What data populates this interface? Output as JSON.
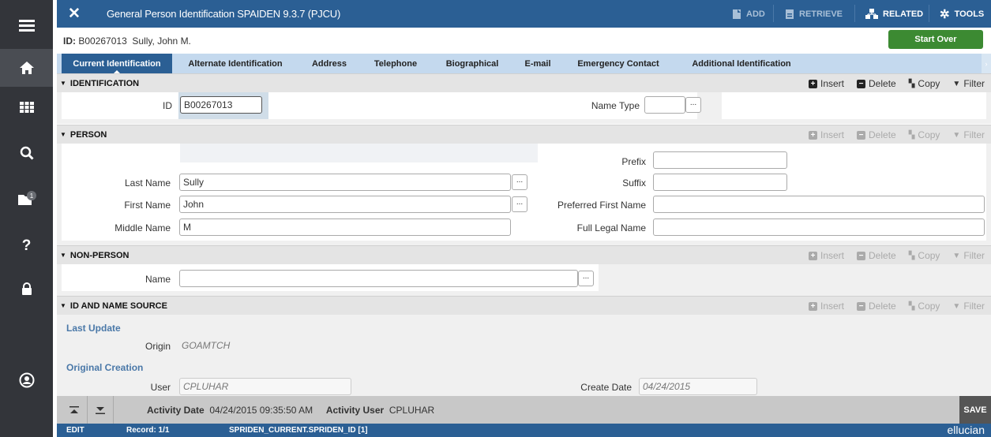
{
  "header": {
    "title": "General Person Identification SPAIDEN 9.3.7 (PJCU)",
    "add": "ADD",
    "retrieve": "RETRIEVE",
    "related": "RELATED",
    "tools": "TOOLS"
  },
  "idbar": {
    "label": "ID:",
    "id": "B00267013",
    "name": "Sully, John M.",
    "start_over": "Start Over"
  },
  "sidebar": {
    "badge": "1"
  },
  "tabs": [
    "Current Identification",
    "Alternate Identification",
    "Address",
    "Telephone",
    "Biographical",
    "E-mail",
    "Emergency Contact",
    "Additional Identification"
  ],
  "actions": {
    "insert": "Insert",
    "delete": "Delete",
    "copy": "Copy",
    "filter": "Filter"
  },
  "identification": {
    "title": "IDENTIFICATION",
    "id_label": "ID",
    "id_value": "B00267013",
    "name_type_label": "Name Type",
    "name_type_value": ""
  },
  "person": {
    "title": "PERSON",
    "last_name_label": "Last Name",
    "last_name": "Sully",
    "first_name_label": "First Name",
    "first_name": "John",
    "middle_name_label": "Middle Name",
    "middle_name": "M",
    "prefix_label": "Prefix",
    "prefix": "",
    "suffix_label": "Suffix",
    "suffix": "",
    "preferred_first_name_label": "Preferred First Name",
    "preferred_first_name": "",
    "full_legal_name_label": "Full Legal Name",
    "full_legal_name": ""
  },
  "non_person": {
    "title": "NON-PERSON",
    "name_label": "Name",
    "name": ""
  },
  "source": {
    "title": "ID AND NAME SOURCE",
    "last_update": "Last Update",
    "origin_label": "Origin",
    "origin": "GOAMTCH",
    "original_creation": "Original Creation",
    "user_label": "User",
    "user": "CPLUHAR",
    "create_date_label": "Create Date",
    "create_date": "04/24/2015"
  },
  "footer": {
    "activity_date_label": "Activity Date",
    "activity_date": "04/24/2015 09:35:50 AM",
    "activity_user_label": "Activity User",
    "activity_user": "CPLUHAR",
    "save": "SAVE",
    "mode": "EDIT",
    "record": "Record: 1/1",
    "field": "SPRIDEN_CURRENT.SPRIDEN_ID [1]",
    "brand": "ellucian"
  }
}
